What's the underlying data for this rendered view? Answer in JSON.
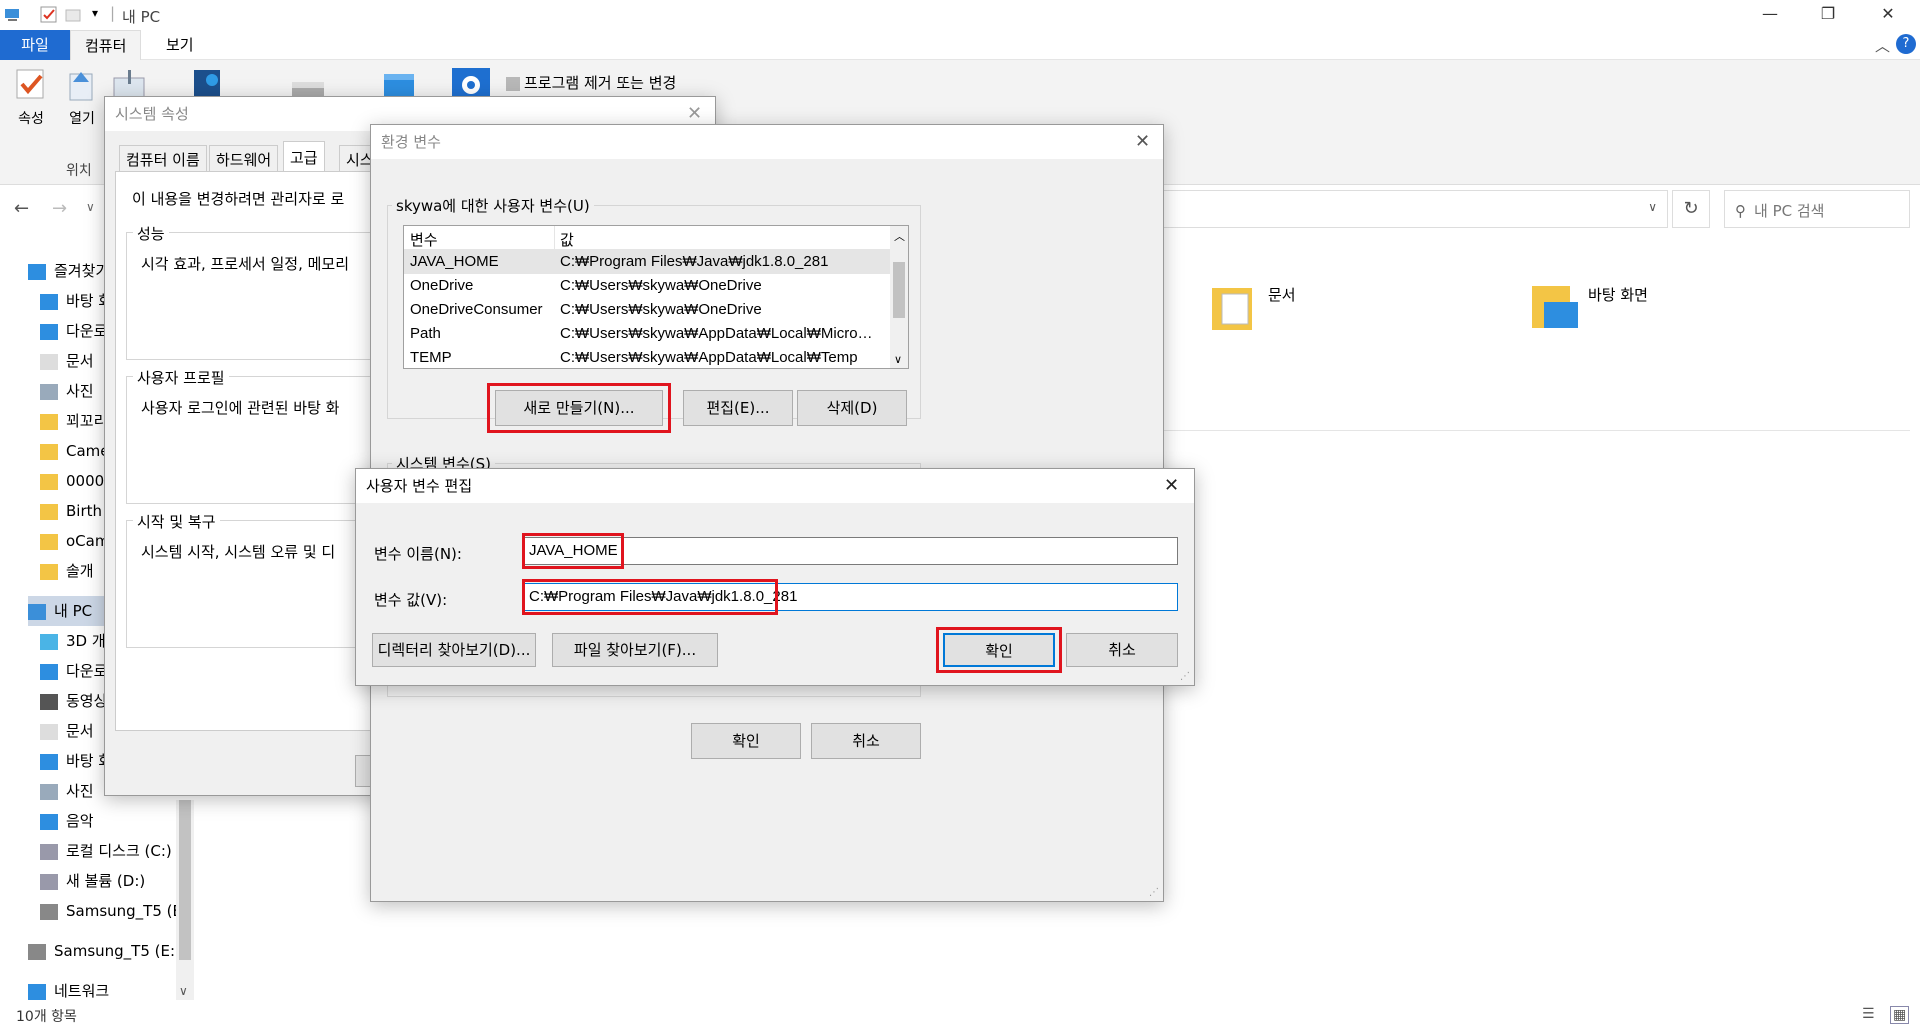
{
  "explorer": {
    "title": "내 PC",
    "tabs": [
      "파일",
      "컴퓨터",
      "보기"
    ],
    "ribbon": {
      "properties": "속성",
      "open": "열기",
      "location_group": "위치",
      "uninstall": "프로그램 제거 또는 변경"
    },
    "search_placeholder": "내 PC 검색",
    "sidebar": [
      {
        "label": "즐겨찾기",
        "icon": "star-icon"
      },
      {
        "label": "바탕 화",
        "icon": "desktop-icon"
      },
      {
        "label": "다운로",
        "icon": "download-icon"
      },
      {
        "label": "문서",
        "icon": "document-icon"
      },
      {
        "label": "사진",
        "icon": "picture-icon"
      },
      {
        "label": "꾀꼬리",
        "icon": "folder-icon"
      },
      {
        "label": "Came",
        "icon": "folder-icon"
      },
      {
        "label": "0000",
        "icon": "folder-icon"
      },
      {
        "label": "Birth",
        "icon": "folder-icon"
      },
      {
        "label": "oCam",
        "icon": "folder-icon"
      },
      {
        "label": "솔개",
        "icon": "folder-icon"
      },
      {
        "label": "내 PC",
        "icon": "pc-icon"
      },
      {
        "label": "3D 개",
        "icon": "3d-objects-icon"
      },
      {
        "label": "다운로",
        "icon": "download-icon"
      },
      {
        "label": "동영상",
        "icon": "video-icon"
      },
      {
        "label": "문서",
        "icon": "document-icon"
      },
      {
        "label": "바탕 화",
        "icon": "desktop-icon"
      },
      {
        "label": "사진",
        "icon": "picture-icon"
      },
      {
        "label": "음악",
        "icon": "music-icon"
      },
      {
        "label": "로컬 디스크 (C:)",
        "icon": "disk-icon"
      },
      {
        "label": "새 볼륨 (D:)",
        "icon": "disk-icon"
      },
      {
        "label": "Samsung_T5 (E:)",
        "icon": "usb-drive-icon"
      },
      {
        "label": "Samsung_T5 (E:)",
        "icon": "usb-drive-icon"
      },
      {
        "label": "네트워크",
        "icon": "network-icon"
      }
    ],
    "folders": [
      "문서",
      "바탕 화면"
    ],
    "status": "10개 항목"
  },
  "system_props": {
    "title": "시스템 속성",
    "tabs": [
      "컴퓨터 이름",
      "하드웨어",
      "고급",
      "시스"
    ],
    "admin_note": "이 내용을 변경하려면 관리자로 로",
    "perf_label": "성능",
    "perf_text": "시각 효과, 프로세서 일정, 메모리",
    "profile_label": "사용자 프로필",
    "profile_text": "사용자 로그인에 관련된 바탕 화",
    "startup_label": "시작 및 복구",
    "startup_text": "시스템 시작, 시스템 오류 및 디"
  },
  "env_vars": {
    "title": "환경 변수",
    "user_group": "skywa에 대한 사용자 변수(U)",
    "col_var": "변수",
    "col_val": "값",
    "rows": [
      {
        "name": "JAVA_HOME",
        "value": "C:₩Program Files₩Java₩jdk1.8.0_281"
      },
      {
        "name": "OneDrive",
        "value": "C:₩Users₩skywa₩OneDrive"
      },
      {
        "name": "OneDriveConsumer",
        "value": "C:₩Users₩skywa₩OneDrive"
      },
      {
        "name": "Path",
        "value": "C:₩Users₩skywa₩AppData₩Local₩Microsoft..."
      },
      {
        "name": "TEMP",
        "value": "C:₩Users₩skywa₩AppData₩Local₩Temp"
      }
    ],
    "new_btn": "새로 만들기(N)...",
    "edit_btn": "편집(E)...",
    "delete_btn": "삭제(D)",
    "sys_group": "시스템 변수(S)",
    "ok": "확인",
    "cancel": "취소"
  },
  "edit_dialog": {
    "title": "사용자 변수 편집",
    "name_label": "변수 이름(N):",
    "name_value": "JAVA_HOME",
    "value_label": "변수 값(V):",
    "value_value": "C:₩Program Files₩Java₩jdk1.8.0_281",
    "browse_dir": "디렉터리 찾아보기(D)...",
    "browse_file": "파일 찾아보기(F)...",
    "ok": "확인",
    "cancel": "취소"
  }
}
